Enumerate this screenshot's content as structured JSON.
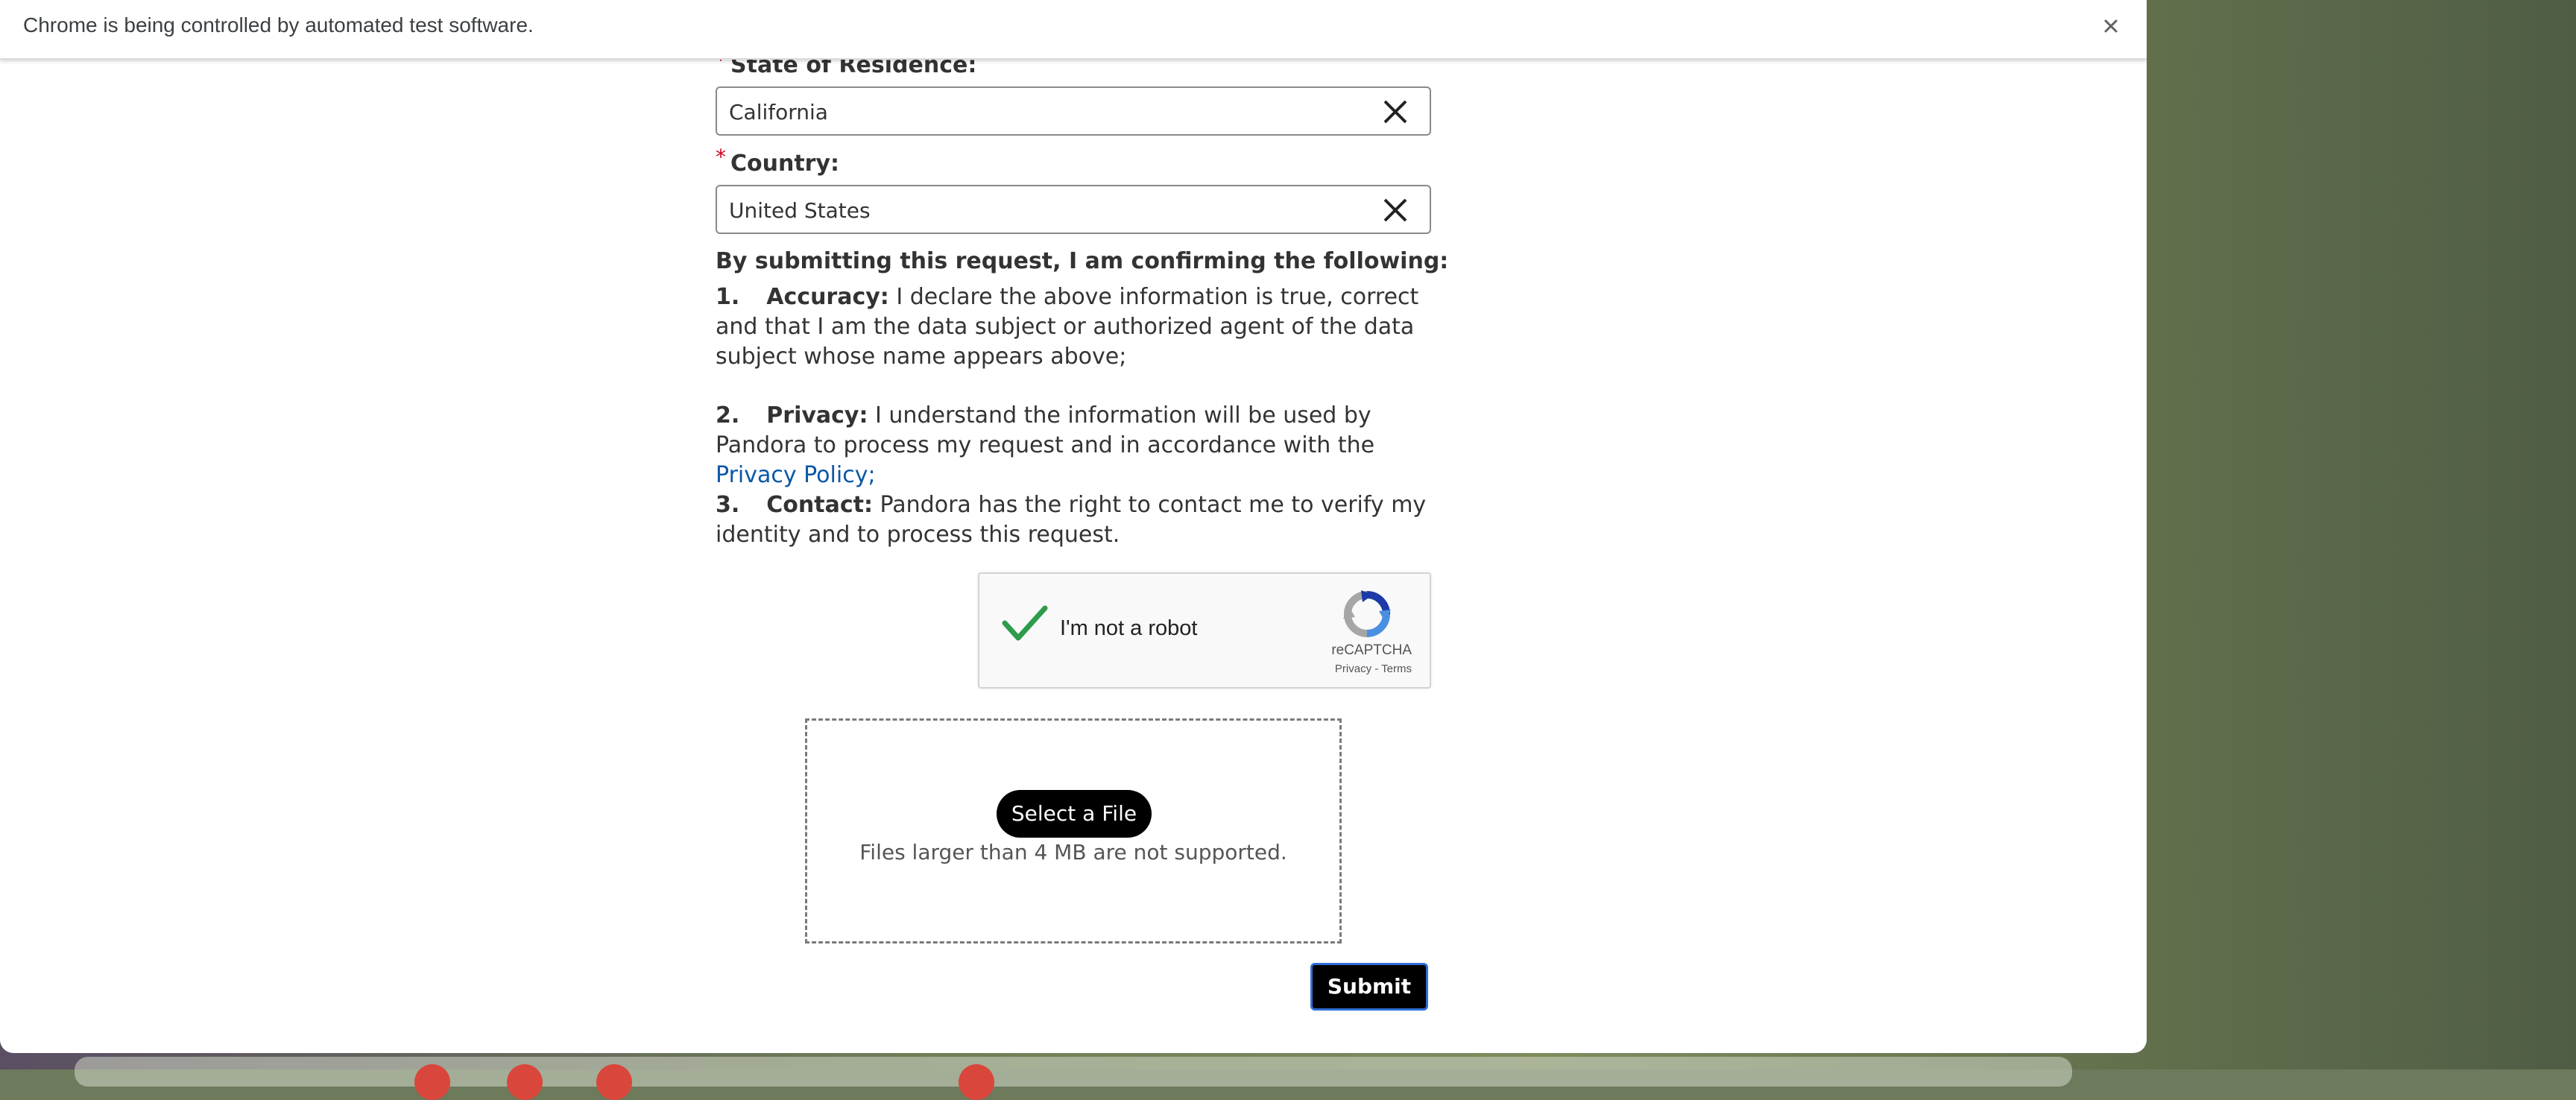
{
  "infobar": {
    "message": "Chrome is being controlled by automated test software."
  },
  "form": {
    "state": {
      "required_mark": "*",
      "label": "State of Residence:",
      "value": "California"
    },
    "country": {
      "required_mark": "*",
      "label": "Country:",
      "value": "United States"
    },
    "confirm_heading": "By submitting this request, I am confirming the following:",
    "items": [
      {
        "number": "1.",
        "term": "Accuracy:",
        "text": "I declare the above information is true, correct and that I am the data subject or authorized agent of the data subject whose name appears above;"
      },
      {
        "number": "2.",
        "term": "Privacy:",
        "text_before_link": "I understand the information will be used by Pandora to process my request and in accordance with the",
        "link": "Privacy Policy;"
      },
      {
        "number": "3.",
        "term": "Contact:",
        "text": "Pandora has the right to contact me to verify my identity and to process this request."
      }
    ]
  },
  "recaptcha": {
    "label": "I'm not a robot",
    "brand": "reCAPTCHA",
    "privacy": "Privacy",
    "separator": "-",
    "terms": "Terms",
    "checked": true,
    "check_color": "#2e9c4a"
  },
  "upload": {
    "button": "Select a File",
    "note": "Files larger than 4 MB are not supported."
  },
  "submit": {
    "label": "Submit"
  },
  "colors": {
    "required": "#d0021b",
    "link": "#0b57a6",
    "button": "#000000",
    "focus_ring": "#2f6fd6"
  }
}
